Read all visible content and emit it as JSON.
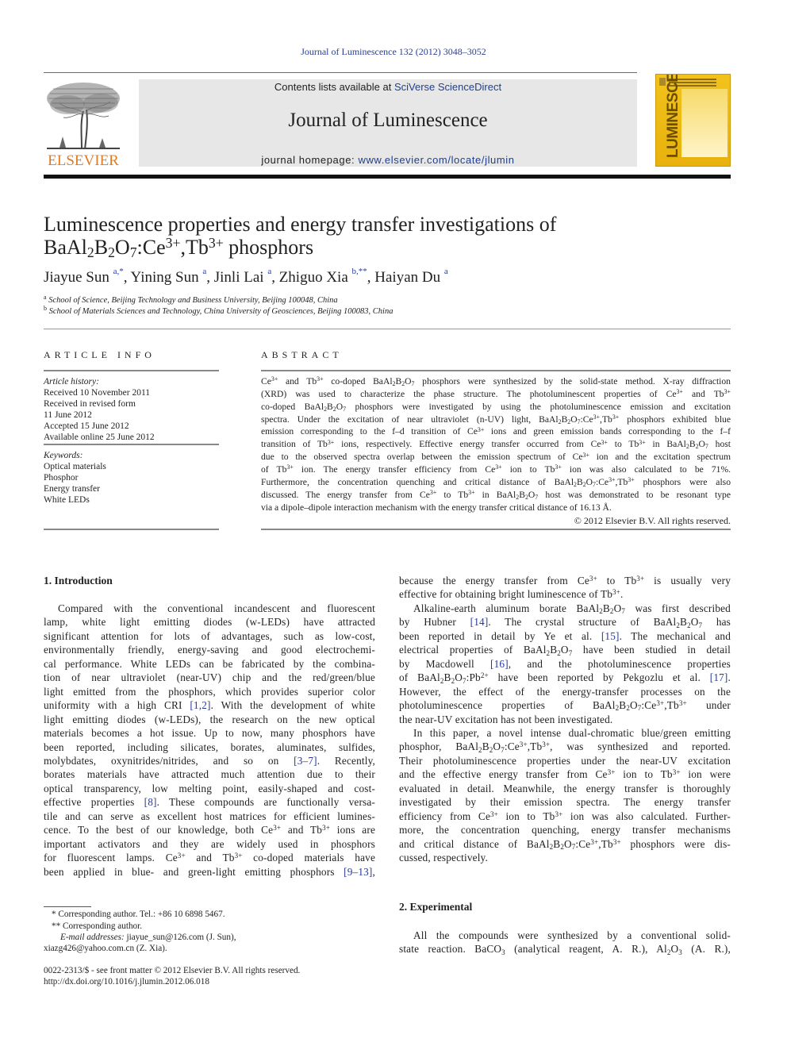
{
  "running_header": "Journal of Luminescence 132 (2012) 3048–3052",
  "masthead": {
    "publisher": "ELSEVIER",
    "contents_prefix": "Contents lists available at ",
    "contents_link": "SciVerse ScienceDirect",
    "journal_name": "Journal of Luminescence",
    "homepage_prefix": "journal homepage: ",
    "homepage_link": "www.elsevier.com/locate/jlumin",
    "cover_title": "LUMINESCENCE",
    "cover_color": "#f2c21b",
    "publisher_color": "#e07b22"
  },
  "article": {
    "title_line1": "Luminescence properties and energy transfer investigations of",
    "title_line2_html": "BaAl<sub>2</sub>B<sub>2</sub>O<sub>7</sub>:Ce<sup>3+</sup>,Tb<sup>3+</sup> phosphors",
    "authors": [
      {
        "name": "Jiayue Sun",
        "marks": "a,*"
      },
      {
        "name": "Yining Sun",
        "marks": "a"
      },
      {
        "name": "Jinli Lai",
        "marks": "a"
      },
      {
        "name": "Zhiguo Xia",
        "marks": "b,**"
      },
      {
        "name": "Haiyan Du",
        "marks": "a"
      }
    ],
    "affiliations": [
      {
        "mark": "a",
        "text": "School of Science, Beijing Technology and Business University, Beijing 100048, China"
      },
      {
        "mark": "b",
        "text": "School of Materials Sciences and Technology, China University of Geosciences, Beijing 100083, China"
      }
    ]
  },
  "article_info": {
    "heading": "ARTICLE INFO",
    "history_label": "Article history:",
    "history": [
      "Received 10 November 2011",
      "Received in revised form",
      "11 June 2012",
      "Accepted 15 June 2012",
      "Available online 25 June 2012"
    ],
    "keywords_label": "Keywords:",
    "keywords": [
      "Optical materials",
      "Phosphor",
      "Energy transfer",
      "White LEDs"
    ]
  },
  "abstract": {
    "heading": "ABSTRACT",
    "lines": [
      "Ce<sup>3+</sup> and Tb<sup>3+</sup> co-doped BaAl<sub>2</sub>B<sub>2</sub>O<sub>7</sub> phosphors were synthesized by the solid-state method. X-ray diffraction",
      "(XRD) was used to characterize the phase structure. The photoluminescent properties of Ce<sup>3+</sup> and Tb<sup>3+</sup>",
      "co-doped BaAl<sub>2</sub>B<sub>2</sub>O<sub>7</sub> phosphors were investigated by using the photoluminescence emission and excitation",
      "spectra. Under the excitation of near ultraviolet (n-UV) light, BaAl<sub>2</sub>B<sub>2</sub>O<sub>7</sub>:Ce<sup>3+</sup>,Tb<sup>3+</sup> phosphors exhibited blue",
      "emission corresponding to the f–d transition of Ce<sup>3+</sup> ions and green emission bands corresponding to the f–f",
      "transition of Tb<sup>3+</sup> ions, respectively. Effective energy transfer occurred from Ce<sup>3+</sup> to Tb<sup>3+</sup> in BaAl<sub>2</sub>B<sub>2</sub>O<sub>7</sub> host",
      "due to the observed spectra overlap between the emission spectrum of Ce<sup>3+</sup> ion and the excitation spectrum",
      "of Tb<sup>3+</sup> ion. The energy transfer efficiency from Ce<sup>3+</sup> ion to Tb<sup>3+</sup> ion was also calculated to be 71%.",
      "Furthermore, the concentration quenching and critical distance of BaAl<sub>2</sub>B<sub>2</sub>O<sub>7</sub>:Ce<sup>3+</sup>,Tb<sup>3+</sup> phosphors were also",
      "discussed. The energy transfer from Ce<sup>3+</sup> to Tb<sup>3+</sup> in BaAl<sub>2</sub>B<sub>2</sub>O<sub>7</sub> host was demonstrated to be resonant type",
      "via a dipole–dipole interaction mechanism with the energy transfer critical distance of 16.13 Å."
    ],
    "copyright": "© 2012 Elsevier B.V. All rights reserved."
  },
  "introduction": {
    "heading": "1.  Introduction",
    "left_lines": [
      "Compared with the conventional incandescent and fluorescent",
      "lamp, white light emitting diodes (w-LEDs) have attracted",
      "significant attention for lots of advantages, such as low-cost,",
      "environmentally friendly, energy-saving and good electrochemi-",
      "cal performance. White LEDs can be fabricated by the combina-",
      "tion of near ultraviolet (near-UV) chip and the red/green/blue",
      "light emitted from the phosphors, which provides superior color",
      "uniformity with a high CRI <span class=\"cite\">[1,2]</span>. With the development of white",
      "light emitting diodes (w-LEDs), the research on the new optical",
      "materials becomes a hot issue. Up to now, many phosphors have",
      "been reported, including silicates, borates, aluminates, sulfides,",
      "molybdates, oxynitrides/nitrides, and so on <span class=\"cite\">[3–7]</span>. Recently,",
      "borates materials have attracted much attention due to their",
      "optical transparency, low melting point, easily-shaped and cost-",
      "effective properties <span class=\"cite\">[8]</span>. These compounds are functionally versa-",
      "tile and can serve as excellent host matrices for efficient lumines-",
      "cence. To the best of our knowledge, both Ce<sup>3+</sup> and Tb<sup>3+</sup> ions are",
      "important activators and they are widely used in phosphors",
      "for fluorescent lamps. Ce<sup>3+</sup> and Tb<sup>3+</sup> co-doped materials have",
      "been applied in blue- and green-light emitting phosphors <span class=\"cite\">[9–13]</span>,"
    ],
    "right_p1_lines": [
      "because the energy transfer from Ce<sup>3+</sup> to Tb<sup>3+</sup> is usually very",
      "effective for obtaining bright luminescence of Tb<sup>3+</sup>."
    ],
    "right_p2_lines": [
      "Alkaline-earth aluminum borate BaAl<sub>2</sub>B<sub>2</sub>O<sub>7</sub> was first described",
      "by Hubner <span class=\"cite\">[14]</span>. The crystal structure of BaAl<sub>2</sub>B<sub>2</sub>O<sub>7</sub> has",
      "been reported in detail by Ye et al. <span class=\"cite\">[15]</span>. The mechanical and",
      "electrical properties of BaAl<sub>2</sub>B<sub>2</sub>O<sub>7</sub> have been studied in detail",
      "by Macdowell <span class=\"cite\">[16]</span>, and the photoluminescence properties",
      "of BaAl<sub>2</sub>B<sub>2</sub>O<sub>7</sub>:Pb<sup>2+</sup> have been reported by Pekgozlu et al. <span class=\"cite\">[17]</span>.",
      "However, the effect of the energy-transfer processes on the",
      "photoluminescence properties of BaAl<sub>2</sub>B<sub>2</sub>O<sub>7</sub>:Ce<sup>3+</sup>,Tb<sup>3+</sup> under",
      "the near-UV excitation has not been investigated."
    ],
    "right_p3_lines": [
      "In this paper, a novel intense dual-chromatic blue/green emitting",
      "phosphor, BaAl<sub>2</sub>B<sub>2</sub>O<sub>7</sub>:Ce<sup>3+</sup>,Tb<sup>3+</sup>, was synthesized and reported.",
      "Their photoluminescence properties under the near-UV excitation",
      "and the effective energy transfer from Ce<sup>3+</sup> ion to Tb<sup>3+</sup> ion were",
      "evaluated in detail. Meanwhile, the energy transfer is thoroughly",
      "investigated by their emission spectra. The energy transfer",
      "efficiency from Ce<sup>3+</sup> ion to Tb<sup>3+</sup> ion was also calculated. Further-",
      "more, the concentration quenching, energy transfer mechanisms",
      "and critical distance of BaAl<sub>2</sub>B<sub>2</sub>O<sub>7</sub>:Ce<sup>3+</sup>,Tb<sup>3+</sup> phosphors were dis-",
      "cussed, respectively."
    ]
  },
  "experimental": {
    "heading": "2.  Experimental",
    "lines": [
      "All the compounds were synthesized by a conventional solid-",
      "state reaction. BaCO<sub>3</sub> (analytical reagent, A. R.), Al<sub>2</sub>O<sub>3</sub> (A. R.),"
    ]
  },
  "footnotes": {
    "lines": [
      "* Corresponding author. Tel.: +86 10 6898 5467.",
      "** Corresponding author."
    ],
    "email_label": "E-mail addresses:",
    "email_1": "jiayue_sun@126.com (J. Sun),",
    "email_2": "xiazg426@yahoo.com.cn (Z. Xia).",
    "front_matter": "0022-2313/$ - see front matter © 2012 Elsevier B.V. All rights reserved.",
    "doi": "http://dx.doi.org/10.1016/j.jlumin.2012.06.018"
  }
}
